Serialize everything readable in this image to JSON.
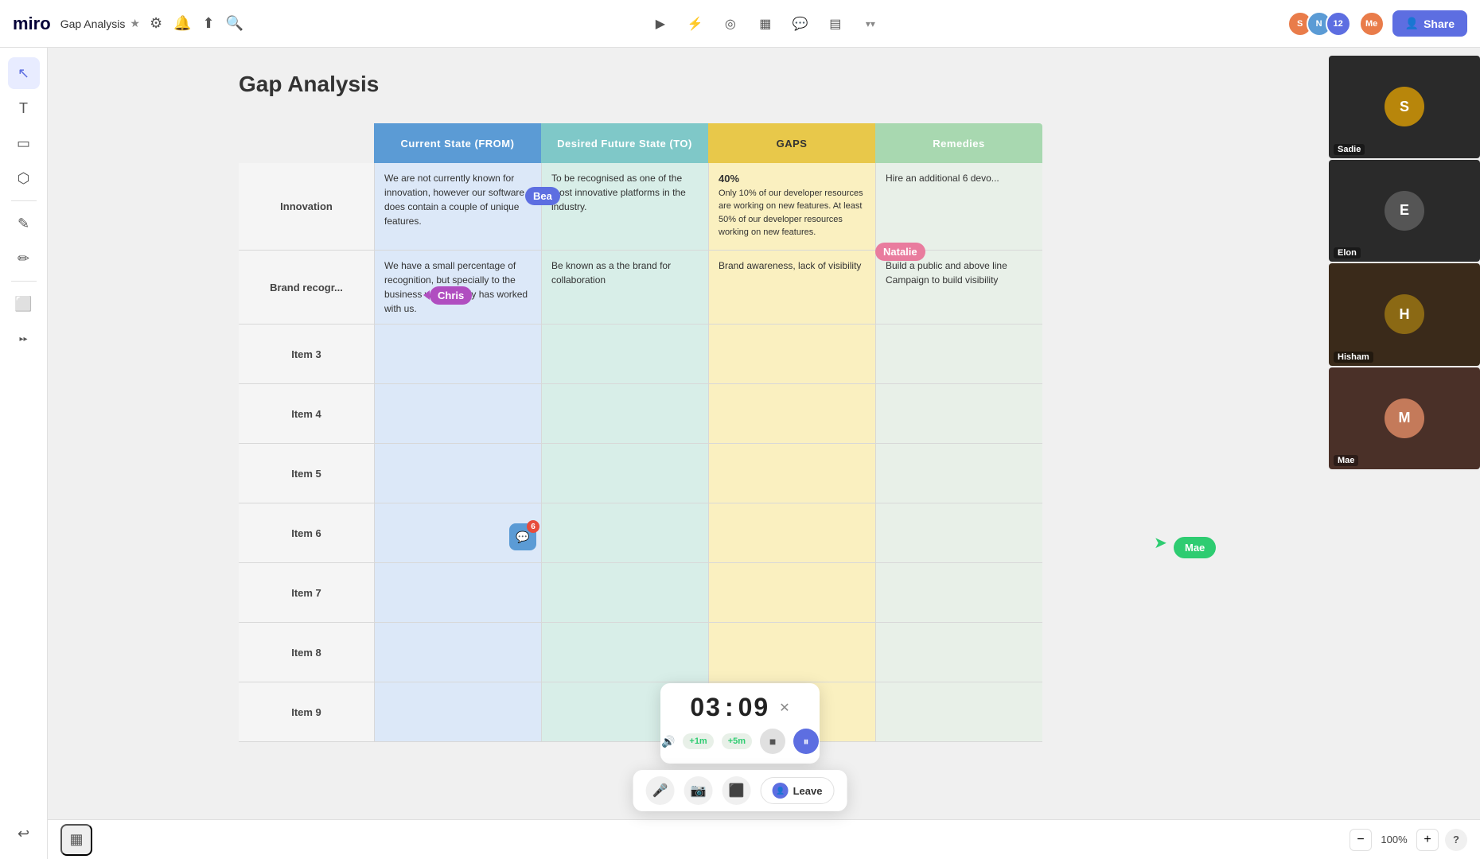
{
  "topbar": {
    "logo": "miro",
    "board_title": "Gap Analysis",
    "star_icon": "★",
    "share_label": "Share",
    "avatar_count": "12"
  },
  "toolbar": {
    "tools": [
      {
        "name": "select",
        "icon": "↖",
        "active": true
      },
      {
        "name": "text",
        "icon": "T",
        "active": false
      },
      {
        "name": "sticky",
        "icon": "◻",
        "active": false
      },
      {
        "name": "shapes",
        "icon": "⬡",
        "active": false
      },
      {
        "name": "pen",
        "icon": "✎",
        "active": false
      },
      {
        "name": "draw",
        "icon": "✏",
        "active": false
      },
      {
        "name": "frame",
        "icon": "⬜",
        "active": false
      }
    ],
    "undo_icon": "↩"
  },
  "board": {
    "heading": "Gap Analysis",
    "table": {
      "headers": [
        "Current State (FROM)",
        "Desired Future State (TO)",
        "GAPS",
        "Remedies"
      ],
      "rows": [
        {
          "label": "Innovation",
          "current": "We are not currently known for innovation, however our software does contain a couple of unique features.",
          "future": "To be recognised as one of the most innovative platforms in the industry.",
          "gaps": "40%\nOnly 10% of our developer resources are working on new features. At least 50% of our developer resources working on new features.",
          "remedies": "Hire an additional 6 devo..."
        },
        {
          "label": "Brand recogr...",
          "current": "We have a small percentage of recognition, but specially to the business who already has worked with us.",
          "future": "Be known as a the brand for collaboration",
          "gaps": "Brand awareness, lack of visibility",
          "remedies": "Build a public and above line Campaign to build visibility"
        },
        {
          "label": "Item 3",
          "current": "",
          "future": "",
          "gaps": "",
          "remedies": ""
        },
        {
          "label": "Item 4",
          "current": "",
          "future": "",
          "gaps": "",
          "remedies": ""
        },
        {
          "label": "Item 5",
          "current": "",
          "future": "",
          "gaps": "",
          "remedies": ""
        },
        {
          "label": "Item 6",
          "current": "",
          "future": "",
          "gaps": "",
          "remedies": ""
        },
        {
          "label": "Item 7",
          "current": "",
          "future": "",
          "gaps": "",
          "remedies": ""
        },
        {
          "label": "Item 8",
          "current": "",
          "future": "",
          "gaps": "",
          "remedies": ""
        },
        {
          "label": "Item 9",
          "current": "",
          "future": "",
          "gaps": "",
          "remedies": ""
        }
      ]
    }
  },
  "cursors": {
    "bea": "Bea",
    "natalie": "Natalie",
    "chris": "Chris",
    "mae": "Mae"
  },
  "comment": {
    "count": "6"
  },
  "timer": {
    "minutes": "03",
    "seconds": "09",
    "plus1": "+1m",
    "plus5": "+5m",
    "stop_label": "■",
    "pause_label": "⏸"
  },
  "meeting": {
    "mic_icon": "🎤",
    "camera_icon": "📷",
    "screen_icon": "⬛",
    "leave_label": "Leave"
  },
  "video_panel": {
    "participants": [
      {
        "name": "Sadie",
        "bg": "#b8860b"
      },
      {
        "name": "Elon",
        "bg": "#555"
      },
      {
        "name": "Hisham",
        "bg": "#8b6914"
      },
      {
        "name": "Mae",
        "bg": "#c47a5a"
      }
    ]
  },
  "zoom": {
    "level": "100%",
    "minus": "−",
    "plus": "+"
  },
  "help": "?"
}
